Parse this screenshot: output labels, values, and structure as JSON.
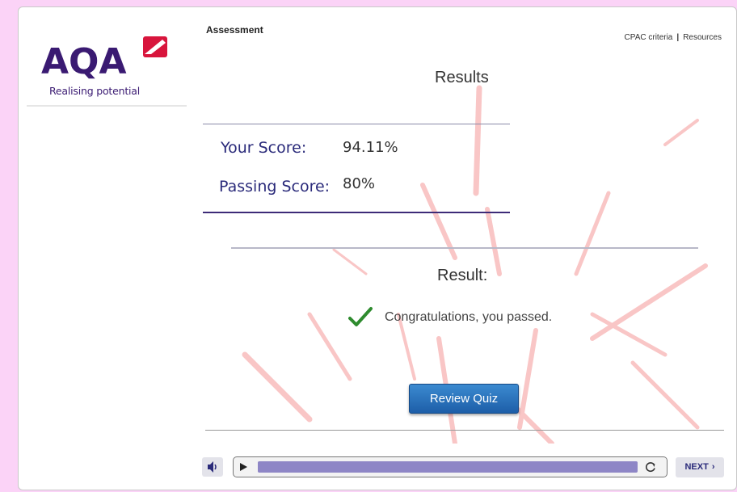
{
  "header": {
    "section_title": "Assessment",
    "links": [
      "CPAC criteria",
      "Resources"
    ],
    "separator": "|"
  },
  "brand": {
    "logo_text": "AQA",
    "tagline": "Realising potential",
    "primary_color": "#3a1a72",
    "accent_color": "#d8153c"
  },
  "results": {
    "title": "Results",
    "your_score_label": "Your Score:",
    "your_score_value": "94.11%",
    "passing_score_label": "Passing Score:",
    "passing_score_value": "80%"
  },
  "result": {
    "heading": "Result:",
    "message": "Congratulations, you passed.",
    "status_icon": "checkmark-icon",
    "status_color": "#2e8b2e"
  },
  "actions": {
    "review_label": "Review Quiz"
  },
  "player": {
    "mute_icon": "speaker-icon",
    "play_icon": "play-icon",
    "replay_icon": "replay-icon",
    "progress": 1.0,
    "next_label": "NEXT",
    "next_icon": "chevron-right-icon"
  }
}
